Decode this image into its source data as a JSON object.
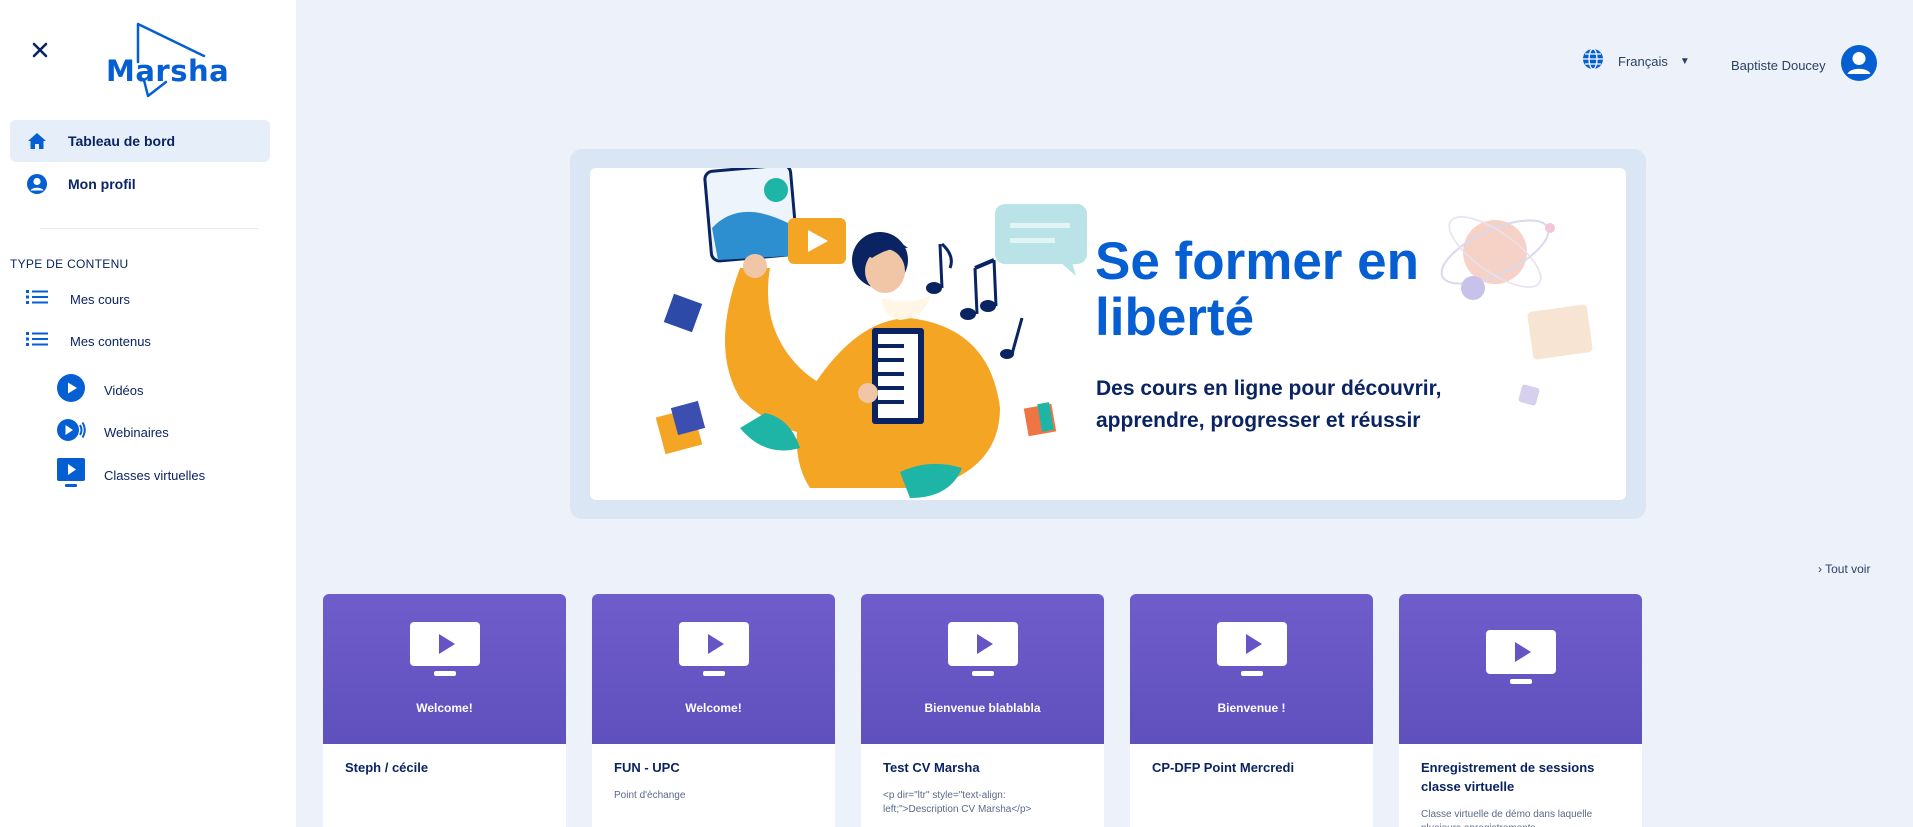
{
  "sidebar": {
    "logo_text": "Marsha",
    "nav": [
      {
        "label": "Tableau de bord",
        "icon": "home-icon",
        "active": true
      },
      {
        "label": "Mon profil",
        "icon": "user-circle-icon",
        "active": false
      }
    ],
    "section_title": "TYPE DE CONTENU",
    "content_types": [
      {
        "label": "Mes cours",
        "icon": "list-icon"
      },
      {
        "label": "Mes contenus",
        "icon": "list-icon"
      }
    ],
    "sub_types": [
      {
        "label": "Vidéos",
        "icon": "play-circle-icon"
      },
      {
        "label": "Webinaires",
        "icon": "webinar-icon"
      },
      {
        "label": "Classes virtuelles",
        "icon": "monitor-play-icon"
      }
    ]
  },
  "header": {
    "language": "Français",
    "language_icon": "globe-icon",
    "user_name": "Baptiste Doucey",
    "user_icon": "user-circle-icon"
  },
  "banner": {
    "title": "Se former en liberté",
    "subtitle": "Des cours en ligne pour découvrir, apprendre, progresser et réussir"
  },
  "see_all": "› Tout voir",
  "cards": [
    {
      "thumb_title": "Welcome!",
      "name": "Steph / cécile",
      "desc": ""
    },
    {
      "thumb_title": "Welcome!",
      "name": "FUN - UPC",
      "desc": "Point d'échange"
    },
    {
      "thumb_title": "Bienvenue blablabla",
      "name": "Test CV Marsha",
      "desc": "<p dir=\"ltr\" style=\"text-align: left;\">Description CV Marsha</p>"
    },
    {
      "thumb_title": "Bienvenue !",
      "name": "CP-DFP Point Mercredi",
      "desc": ""
    },
    {
      "thumb_title": "",
      "name": "Enregistrement de sessions classe virtuelle",
      "desc": "Classe virtuelle de démo dans laquelle plusieurs enregistrements"
    }
  ],
  "colors": {
    "brand": "#055fd2",
    "navy": "#0a2463",
    "card_purple": "#6454c4",
    "background": "#edf2fa"
  }
}
